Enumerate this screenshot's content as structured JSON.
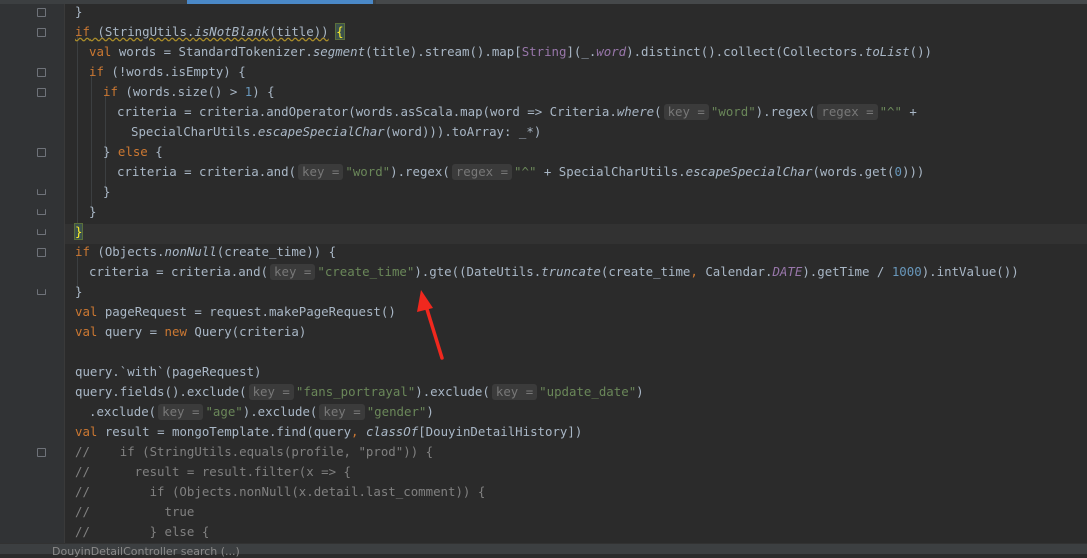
{
  "status": {
    "breadcrumb": "DouyinDetailController  search (...)"
  },
  "lines": [
    {
      "segs": [
        [
          "p",
          "}"
        ]
      ]
    },
    {
      "segs": [
        [
          "kw-warn",
          "if"
        ],
        [
          "p-warn",
          " (StringUtils."
        ],
        [
          "it-warn",
          "isNotBlank"
        ],
        [
          "p-warn",
          "(title))"
        ],
        [
          "p",
          " "
        ],
        [
          "bh",
          "{"
        ]
      ]
    },
    {
      "segs": [
        [
          "kw",
          "val"
        ],
        [
          "p",
          " words = StandardTokenizer."
        ],
        [
          "it",
          "segment"
        ],
        [
          "p",
          "(title).stream().map["
        ],
        [
          "type",
          "String"
        ],
        [
          "p",
          "](_."
        ],
        [
          "fld",
          "word"
        ],
        [
          "p",
          ").distinct().collect(Collectors."
        ],
        [
          "it",
          "toList"
        ],
        [
          "p",
          "())"
        ]
      ]
    },
    {
      "segs": [
        [
          "kw",
          "if"
        ],
        [
          "p",
          " (!words.isEmpty) {"
        ]
      ]
    },
    {
      "segs": [
        [
          "kw",
          "if"
        ],
        [
          "p",
          " (words.size() > "
        ],
        [
          "num",
          "1"
        ],
        [
          "p",
          ") {"
        ]
      ]
    },
    {
      "segs": [
        [
          "p",
          "criteria = criteria.andOperator(words.asScala.map(word => Criteria."
        ],
        [
          "it",
          "where"
        ],
        [
          "p",
          "("
        ],
        [
          "hint",
          "key ="
        ],
        [
          "str",
          "\"word\""
        ],
        [
          "p",
          ").regex("
        ],
        [
          "hint",
          "regex ="
        ],
        [
          "str",
          "\"^\""
        ],
        [
          "p",
          " +"
        ]
      ]
    },
    {
      "segs": [
        [
          "p",
          "SpecialCharUtils."
        ],
        [
          "it",
          "escapeSpecialChar"
        ],
        [
          "p",
          "(word))).toArray: _*)"
        ]
      ]
    },
    {
      "segs": [
        [
          "p",
          "} "
        ],
        [
          "kw",
          "else"
        ],
        [
          "p",
          " {"
        ]
      ]
    },
    {
      "segs": [
        [
          "p",
          "criteria = criteria.and("
        ],
        [
          "hint",
          "key ="
        ],
        [
          "str",
          "\"word\""
        ],
        [
          "p",
          ").regex("
        ],
        [
          "hint",
          "regex ="
        ],
        [
          "str",
          "\"^\""
        ],
        [
          "p",
          " + SpecialCharUtils."
        ],
        [
          "it",
          "escapeSpecialChar"
        ],
        [
          "p",
          "(words.get("
        ],
        [
          "num",
          "0"
        ],
        [
          "p",
          ")))"
        ]
      ]
    },
    {
      "segs": [
        [
          "p",
          "}"
        ]
      ]
    },
    {
      "segs": [
        [
          "p",
          "}"
        ]
      ]
    },
    {
      "segs": [
        [
          "bh",
          "}"
        ]
      ]
    },
    {
      "segs": [
        [
          "kw",
          "if"
        ],
        [
          "p",
          " (Objects."
        ],
        [
          "it",
          "nonNull"
        ],
        [
          "p",
          "(create_time)) {"
        ]
      ]
    },
    {
      "segs": [
        [
          "p",
          "criteria = criteria.and("
        ],
        [
          "hint",
          "key ="
        ],
        [
          "str",
          "\"create_time\""
        ],
        [
          "p",
          ").gte((DateUtils."
        ],
        [
          "it",
          "truncate"
        ],
        [
          "p",
          "(create_time"
        ],
        [
          "kw",
          ","
        ],
        [
          "p",
          " Calendar."
        ],
        [
          "fld",
          "DATE"
        ],
        [
          "p",
          ").getTime / "
        ],
        [
          "num",
          "1000"
        ],
        [
          "p",
          ").intValue())"
        ]
      ]
    },
    {
      "segs": [
        [
          "p",
          "}"
        ]
      ]
    },
    {
      "segs": [
        [
          "kw",
          "val"
        ],
        [
          "p",
          " pageRequest = request.makePageRequest()"
        ]
      ]
    },
    {
      "segs": [
        [
          "kw",
          "val"
        ],
        [
          "p",
          " query = "
        ],
        [
          "kw",
          "new"
        ],
        [
          "p",
          " Query(criteria)"
        ]
      ]
    },
    {
      "segs": [
        [
          "p",
          ""
        ]
      ]
    },
    {
      "segs": [
        [
          "p",
          "query.`with`(pageRequest)"
        ]
      ]
    },
    {
      "segs": [
        [
          "p",
          "query.fields().exclude("
        ],
        [
          "hint",
          "key ="
        ],
        [
          "str",
          "\"fans_portrayal\""
        ],
        [
          "p",
          ").exclude("
        ],
        [
          "hint",
          "key ="
        ],
        [
          "str",
          "\"update_date\""
        ],
        [
          "p",
          ")"
        ]
      ]
    },
    {
      "segs": [
        [
          "p",
          ".exclude("
        ],
        [
          "hint",
          "key ="
        ],
        [
          "str",
          "\"age\""
        ],
        [
          "p",
          ").exclude("
        ],
        [
          "hint",
          "key ="
        ],
        [
          "str",
          "\"gender\""
        ],
        [
          "p",
          ")"
        ]
      ]
    },
    {
      "segs": [
        [
          "kw",
          "val"
        ],
        [
          "p",
          " result = mongoTemplate.find(query"
        ],
        [
          "kw",
          ","
        ],
        [
          "p",
          " "
        ],
        [
          "it",
          "classOf"
        ],
        [
          "p",
          "[DouyinDetailHistory])"
        ]
      ]
    },
    {
      "segs": [
        [
          "cm",
          "//    if (StringUtils.equals(profile, \"prod\")) {"
        ]
      ]
    },
    {
      "segs": [
        [
          "cm",
          "//      result = result.filter(x => {"
        ]
      ]
    },
    {
      "segs": [
        [
          "cm",
          "//        if (Objects.nonNull(x.detail.last_comment)) {"
        ]
      ]
    },
    {
      "segs": [
        [
          "cm",
          "//          true"
        ]
      ]
    },
    {
      "segs": [
        [
          "cm",
          "//        } else {"
        ]
      ]
    }
  ]
}
